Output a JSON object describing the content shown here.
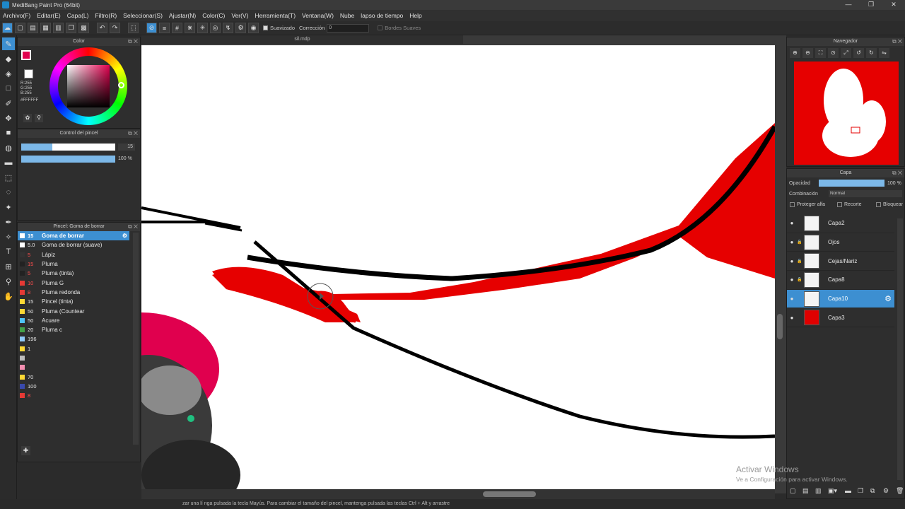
{
  "window": {
    "title": "MediBang Paint Pro (64bit)",
    "min": "—",
    "restore": "❐",
    "close": "✕"
  },
  "menu": [
    "Archivo(F)",
    "Editar(E)",
    "Capa(L)",
    "Filtro(R)",
    "Seleccionar(S)",
    "Ajustar(N)",
    "Color(C)",
    "Ver(V)",
    "Herramienta(T)",
    "Ventana(W)",
    "Nube",
    "lapso de tiempo",
    "Help"
  ],
  "toolbar": {
    "smoothing_label": "Suavizado",
    "correction_label": "Corrección",
    "correction_value": "0",
    "soft_edges_label": "Bordes Suaves"
  },
  "color_panel": {
    "title": "Color",
    "r": "R:255",
    "g": "G:255",
    "b": "B:255",
    "hex": "#FFFFFF"
  },
  "brush_control": {
    "title": "Control del pincel",
    "size": "15",
    "opacity": "100 %",
    "size_fraction": 0.33,
    "opacity_fraction": 1.0
  },
  "brush_panel": {
    "title": "Pincel: Goma de borrar",
    "items": [
      {
        "size": "15",
        "name": "Goma de borrar",
        "color": "#ffffff",
        "selected": true
      },
      {
        "size": "5.0",
        "name": "Goma de borrar (suave)",
        "color": "#ffffff"
      },
      {
        "size": "5",
        "name": "Lápiz",
        "color": "#333333"
      },
      {
        "size": "15",
        "name": "Pluma",
        "color": "#222222"
      },
      {
        "size": "5",
        "name": "Pluma (tinta)",
        "color": "#222222"
      },
      {
        "size": "10",
        "name": "Pluma G",
        "color": "#e53935"
      },
      {
        "size": "8",
        "name": "Pluma redonda",
        "color": "#e53935"
      },
      {
        "size": "15",
        "name": "Pincel (tinta)",
        "color": "#fdd835"
      },
      {
        "size": "50",
        "name": "Pluma (Countear",
        "color": "#fdd835"
      },
      {
        "size": "50",
        "name": "Acuare",
        "color": "#4fc3f7"
      },
      {
        "size": "20",
        "name": "Pluma c",
        "color": "#43a047"
      },
      {
        "size": "196",
        "name": "",
        "color": "#90caf9"
      },
      {
        "size": "1",
        "name": "",
        "color": "#fdd835"
      },
      {
        "size": "",
        "name": "",
        "color": "#bdbdbd"
      },
      {
        "size": "",
        "name": "",
        "color": "#f48fb1"
      },
      {
        "size": "70",
        "name": "",
        "color": "#fdd835"
      },
      {
        "size": "100",
        "name": "",
        "color": "#3949ab"
      },
      {
        "size": "8",
        "name": "",
        "color": "#e53935"
      }
    ]
  },
  "document": {
    "tab_name": "sil.mdp"
  },
  "navigator": {
    "title": "Navegador"
  },
  "layers_panel": {
    "title": "Capa",
    "opacity_label": "Opacidad",
    "opacity_value": "100 %",
    "blend_label": "Combinación",
    "blend_value": "Normal",
    "protect_alpha": "Proteger alfa",
    "clip": "Recorte",
    "lock": "Bloquear",
    "layers": [
      {
        "name": "Capa2",
        "thumb": "#f4f4f4",
        "selected": false
      },
      {
        "name": "Ojos",
        "thumb": "#f4f4f4",
        "selected": false
      },
      {
        "name": "Cejas/Nariz",
        "thumb": "#f4f4f4",
        "selected": false
      },
      {
        "name": "Capa8",
        "thumb": "#f4f4f4",
        "selected": false
      },
      {
        "name": "Capa10",
        "thumb": "#f4f4f4",
        "selected": true
      },
      {
        "name": "Capa3",
        "thumb": "#e00000",
        "selected": false
      }
    ]
  },
  "status": {
    "text": "zar una lí            nga pulsada la tecla Mayús. Para cambiar el tamaño del pincel, mantenga pulsada las teclas Ctrl + Alt y arrastre"
  },
  "watermark": {
    "title": "Activar Windows",
    "subtitle": "Ve a Configuración para activar Windows."
  },
  "colors": {
    "accent": "#3d8fd1",
    "paint_red": "#e60000"
  }
}
